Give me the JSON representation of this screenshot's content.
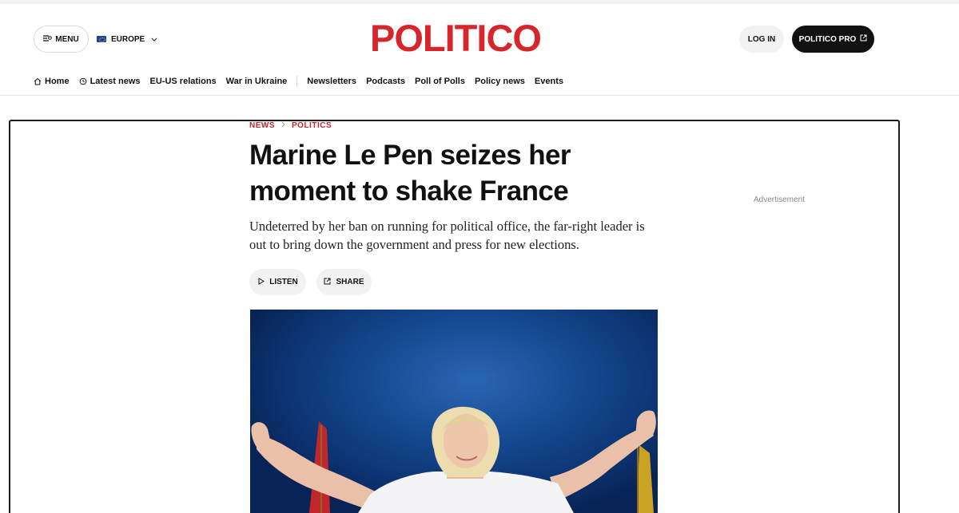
{
  "header": {
    "menu_label": "MENU",
    "edition_label": "EUROPE",
    "logo_text": "POLITICO",
    "login_label": "LOG IN",
    "pro_label": "POLITICO PRO",
    "brand_color": "#d6262c"
  },
  "nav": {
    "home": "Home",
    "latest": "Latest news",
    "eu_us": "EU-US relations",
    "ukraine": "War in Ukraine",
    "newsletters": "Newsletters",
    "podcasts": "Podcasts",
    "poll": "Poll of Polls",
    "policy": "Policy news",
    "events": "Events"
  },
  "article": {
    "crumb_1": "NEWS",
    "crumb_2": "POLITICS",
    "headline": "Marine Le Pen seizes her moment to shake France",
    "dek": "Undeterred by her ban on running for political office, the far-right leader is out to bring down the government and press for new elections.",
    "listen_label": "LISTEN",
    "share_label": "SHARE"
  },
  "sidebar": {
    "ad_label": "Advertisement"
  }
}
